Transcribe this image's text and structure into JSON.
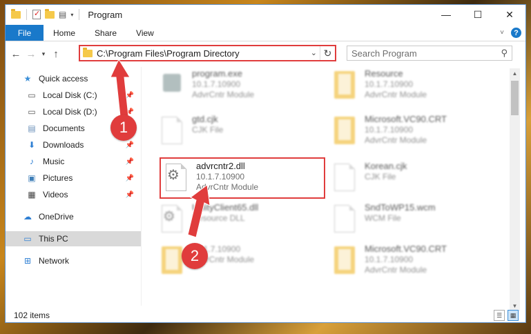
{
  "window": {
    "title": "Program",
    "controls": {
      "minimize": "—",
      "maximize": "☐",
      "close": "✕"
    }
  },
  "ribbon": {
    "tabs": [
      {
        "label": "File",
        "active": true
      },
      {
        "label": "Home"
      },
      {
        "label": "Share"
      },
      {
        "label": "View"
      }
    ]
  },
  "navigation": {
    "address": "C:\\Program Files\\Program Directory",
    "search_placeholder": "Search Program"
  },
  "sidebar": {
    "items": [
      {
        "label": "Quick access",
        "icon": "star-icon",
        "pinned": false
      },
      {
        "label": "Local Disk (C:)",
        "icon": "drive-icon",
        "pinned": true
      },
      {
        "label": "Local Disk (D:)",
        "icon": "drive-icon",
        "pinned": true
      },
      {
        "label": "Documents",
        "icon": "documents-icon",
        "pinned": true
      },
      {
        "label": "Downloads",
        "icon": "download-icon",
        "pinned": true
      },
      {
        "label": "Music",
        "icon": "music-icon",
        "pinned": true
      },
      {
        "label": "Pictures",
        "icon": "pictures-icon",
        "pinned": true
      },
      {
        "label": "Videos",
        "icon": "videos-icon",
        "pinned": true
      },
      {
        "label": "OneDrive",
        "icon": "cloud-icon"
      },
      {
        "label": "This PC",
        "icon": "computer-icon",
        "selected": true
      },
      {
        "label": "Network",
        "icon": "network-icon"
      }
    ]
  },
  "files": [
    {
      "name": "program.exe",
      "version": "10.1.7.10900",
      "type": "AdvrCntr Module",
      "kind": "exe"
    },
    {
      "name": "Resource",
      "version": "10.1.7.10900",
      "type": "AdvrCntr Module",
      "kind": "folder"
    },
    {
      "name": "gtd.cjk",
      "version": "",
      "type": "CJK File",
      "kind": "doc"
    },
    {
      "name": "Microsoft.VC90.CRT",
      "version": "10.1.7.10900",
      "type": "AdvrCntr Module",
      "kind": "folder"
    },
    {
      "name": "advrcntr2.dll",
      "version": "10.1.7.10900",
      "type": "AdvrCntr Module",
      "kind": "gear"
    },
    {
      "name": "Korean.cjk",
      "version": "",
      "type": "CJK File",
      "kind": "doc"
    },
    {
      "name": "UtilityClient65.dll",
      "version": "",
      "type": "Resource DLL",
      "kind": "gear"
    },
    {
      "name": "SndToWP15.wcm",
      "version": "",
      "type": "WCM File",
      "kind": "doc"
    },
    {
      "name": "",
      "version": "10.1.7.10900",
      "type": "AdvrCntr Module",
      "kind": "folder"
    },
    {
      "name": "Microsoft.VC90.CRT",
      "version": "10.1.7.10900",
      "type": "AdvrCntr Module",
      "kind": "folder"
    }
  ],
  "status": {
    "item_count": "102 items"
  },
  "annotations": {
    "step1": "1",
    "step2": "2"
  },
  "colors": {
    "accent": "#1979ca",
    "highlight": "#e03c3c"
  }
}
